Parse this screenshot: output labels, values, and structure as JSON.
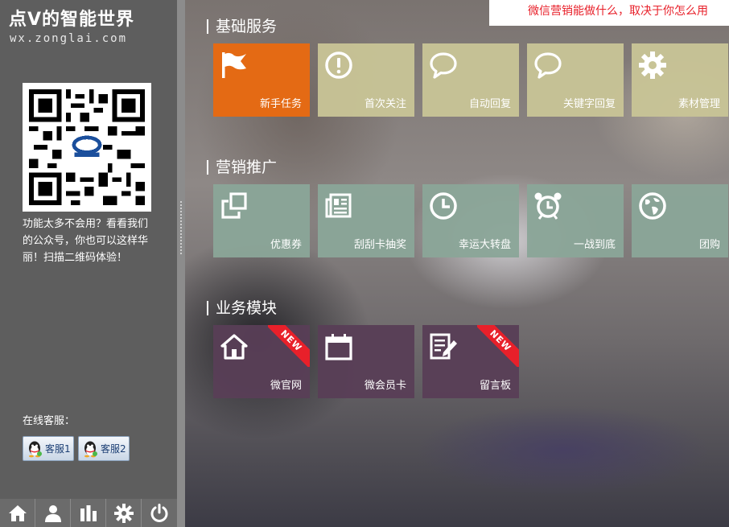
{
  "sidebar": {
    "title": "点V的智能世界",
    "url": "wx.zonglai.com",
    "promo_text": "功能太多不会用？看看我们的公众号，你也可以这样华丽！扫描二维码体验！",
    "customer_service_label": "在线客服：",
    "cs_buttons": [
      {
        "label": "客服1",
        "icon": "qq-penguin-icon"
      },
      {
        "label": "客服2",
        "icon": "qq-penguin-icon"
      }
    ],
    "bottom_icons": [
      "home-icon",
      "user-icon",
      "bar-chart-icon",
      "gear-icon",
      "power-icon"
    ]
  },
  "marquee": {
    "text": "微信营销能做什么，取决于你怎么用"
  },
  "sections": [
    {
      "title": "基础服务",
      "tiles": [
        {
          "label": "新手任务",
          "icon": "flag-icon",
          "color": "#e46a14"
        },
        {
          "label": "首次关注",
          "icon": "exclamation-circle-icon",
          "color": "#c8c496"
        },
        {
          "label": "自动回复",
          "icon": "speech-bubble-icon",
          "color": "#c8c496"
        },
        {
          "label": "关键字回复",
          "icon": "speech-bubble-icon",
          "color": "#c8c496"
        },
        {
          "label": "素材管理",
          "icon": "gear-icon",
          "color": "#c8c496"
        }
      ]
    },
    {
      "title": "营销推广",
      "tiles": [
        {
          "label": "优惠券",
          "icon": "copy-squares-icon",
          "color": "#8aa598"
        },
        {
          "label": "刮刮卡抽奖",
          "icon": "newspaper-icon",
          "color": "#8aa598"
        },
        {
          "label": "幸运大转盘",
          "icon": "clock-icon",
          "color": "#8aa598"
        },
        {
          "label": "一战到底",
          "icon": "alarm-clock-icon",
          "color": "#8aa598"
        },
        {
          "label": "团购",
          "icon": "globe-icon",
          "color": "#8aa598"
        }
      ]
    },
    {
      "title": "业务模块",
      "tiles": [
        {
          "label": "微官网",
          "icon": "house-icon",
          "color": "#583e56",
          "badge": "NEW"
        },
        {
          "label": "微会员卡",
          "icon": "calendar-icon",
          "color": "#583e56"
        },
        {
          "label": "留言板",
          "icon": "edit-note-icon",
          "color": "#583e56",
          "badge": "NEW"
        }
      ]
    }
  ]
}
